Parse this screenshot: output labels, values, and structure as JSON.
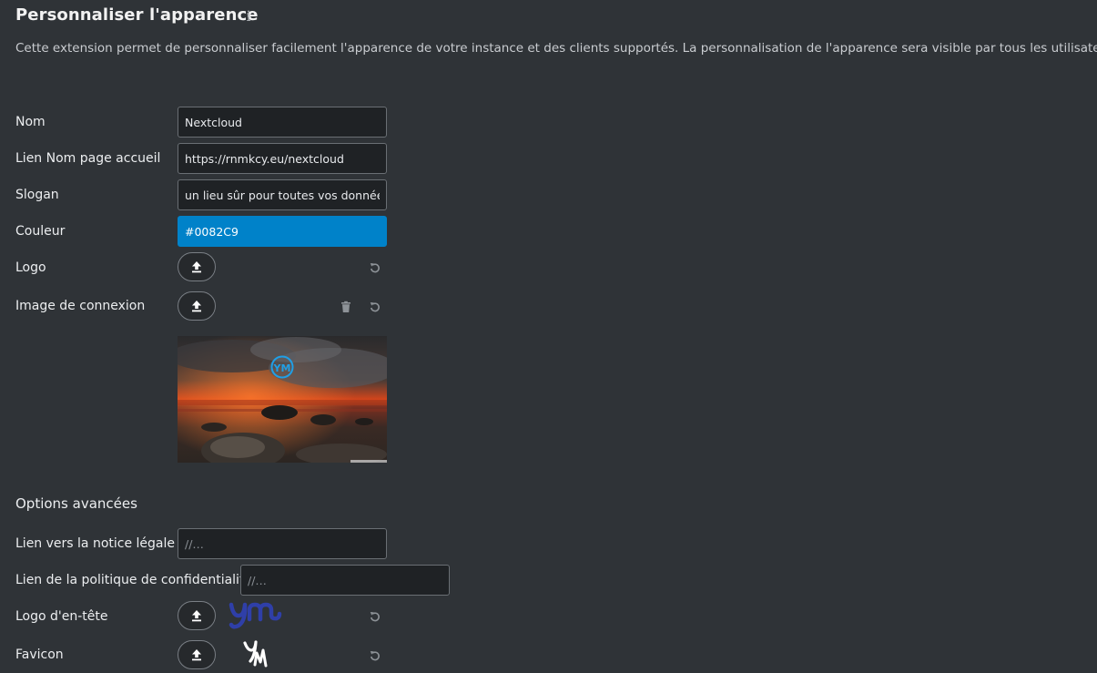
{
  "header": {
    "title": "Personnaliser l'apparence",
    "info_icon": "info-icon",
    "description": "Cette extension permet de personnaliser facilement l'apparence de votre instance et des clients supportés. La personnalisation de l'apparence sera visible par tous les utilisateurs."
  },
  "form": {
    "name": {
      "label": "Nom",
      "value": "Nextcloud"
    },
    "url": {
      "label": "Lien Nom page accueil",
      "value": "https://rnmkcy.eu/nextcloud"
    },
    "slogan": {
      "label": "Slogan",
      "value": "un lieu sûr pour toutes vos données"
    },
    "color": {
      "label": "Couleur",
      "value": "#0082C9",
      "hex": "#0082c9"
    },
    "logo": {
      "label": "Logo"
    },
    "login_image": {
      "label": "Image de connexion"
    }
  },
  "advanced": {
    "title": "Options avancées",
    "imprint": {
      "label": "Lien vers la notice légale",
      "placeholder": "//…"
    },
    "privacy": {
      "label": "Lien de la politique de confidentialité",
      "placeholder": "//…"
    },
    "header_logo": {
      "label": "Logo d'en-tête"
    },
    "favicon": {
      "label": "Favicon"
    }
  }
}
